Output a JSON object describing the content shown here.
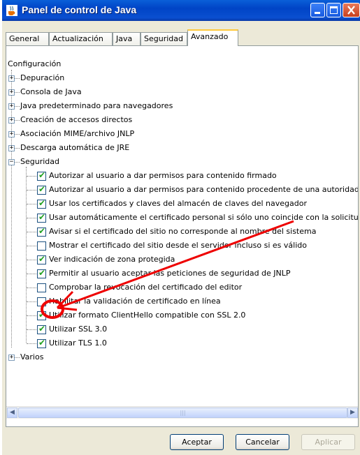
{
  "window": {
    "title": "Panel de control de Java"
  },
  "tabs": [
    {
      "label": "General"
    },
    {
      "label": "Actualización"
    },
    {
      "label": "Java"
    },
    {
      "label": "Seguridad"
    },
    {
      "label": "Avanzado",
      "active": true
    }
  ],
  "tree": {
    "root": "Configuración",
    "items": [
      {
        "label": "Depuración",
        "type": "group",
        "expanded": false
      },
      {
        "label": "Consola de Java",
        "type": "group",
        "expanded": false
      },
      {
        "label": "Java predeterminado para navegadores",
        "type": "group",
        "expanded": false
      },
      {
        "label": "Creación de accesos directos",
        "type": "group",
        "expanded": false
      },
      {
        "label": "Asociación MIME/archivo JNLP",
        "type": "group",
        "expanded": false
      },
      {
        "label": "Descarga automática de JRE",
        "type": "group",
        "expanded": false
      },
      {
        "label": "Seguridad",
        "type": "group",
        "expanded": true
      },
      {
        "label": "Autorizar al usuario a dar permisos para contenido firmado",
        "type": "check",
        "checked": true
      },
      {
        "label": "Autorizar al usuario a dar permisos para contenido procedente de una autoridad",
        "type": "check",
        "checked": true
      },
      {
        "label": "Usar los certificados y claves del almacén de claves del navegador",
        "type": "check",
        "checked": true
      },
      {
        "label": "Usar automáticamente el certificado personal si sólo uno coincide con la solicitud",
        "type": "check",
        "checked": true
      },
      {
        "label": "Avisar si el certificado del sitio no corresponde al nombre del sistema",
        "type": "check",
        "checked": true
      },
      {
        "label": "Mostrar el certificado del sitio desde el servidor incluso si es válido",
        "type": "check",
        "checked": false
      },
      {
        "label": "Ver indicación de zona protegida",
        "type": "check",
        "checked": true
      },
      {
        "label": "Permitir al usuario aceptar las peticiones de seguridad de JNLP",
        "type": "check",
        "checked": true
      },
      {
        "label": "Comprobar la revocación del certificado del editor",
        "type": "check",
        "checked": false
      },
      {
        "label": "Habilitar la validación de certificado en línea",
        "type": "check",
        "checked": false
      },
      {
        "label": "Utilizar formato ClientHello compatible con SSL 2.0",
        "type": "check",
        "checked": true
      },
      {
        "label": "Utilizar SSL 3.0",
        "type": "check",
        "checked": true
      },
      {
        "label": "Utilizar TLS 1.0",
        "type": "check",
        "checked": true
      },
      {
        "label": "Varios",
        "type": "group",
        "expanded": false
      }
    ]
  },
  "buttons": {
    "accept": "Aceptar",
    "cancel": "Cancelar",
    "apply": "Aplicar"
  },
  "colors": {
    "annotation": "#ee0000",
    "title_bar": "#0a5fd8",
    "check": "#21a121"
  }
}
